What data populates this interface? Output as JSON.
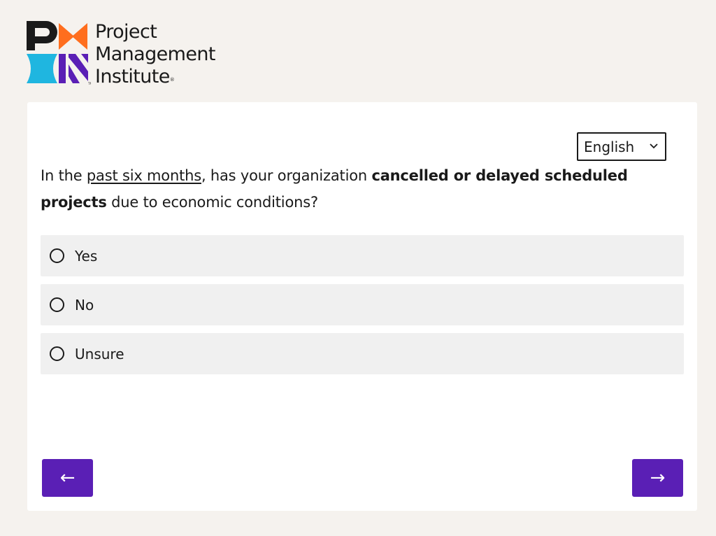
{
  "logo": {
    "line1": "Project",
    "line2": "Management",
    "line3": "Institute",
    "reg_mark": "®",
    "tm_mark": "TM",
    "icon": "pmi-logo-mark",
    "colors": {
      "black": "#1a1a1a",
      "orange": "#ff6e1e",
      "cyan": "#1fb6e0",
      "purple": "#5a1fb5"
    }
  },
  "language": {
    "selected": "English",
    "icon": "chevron-down-icon"
  },
  "question": {
    "part1": "In the ",
    "underlined": "past six months",
    "part2": ", has your organization ",
    "bold": "cancelled or delayed scheduled projects",
    "part3": " due to economic conditions?"
  },
  "options": [
    {
      "label": "Yes",
      "selected": false
    },
    {
      "label": "No",
      "selected": false
    },
    {
      "label": "Unsure",
      "selected": false
    }
  ],
  "navigation": {
    "prev_label": "←",
    "next_label": "→",
    "button_color": "#5a1fb5"
  },
  "colors": {
    "page_background": "#f5f2ee",
    "card_background": "#ffffff",
    "option_background": "#f0f0f0"
  }
}
